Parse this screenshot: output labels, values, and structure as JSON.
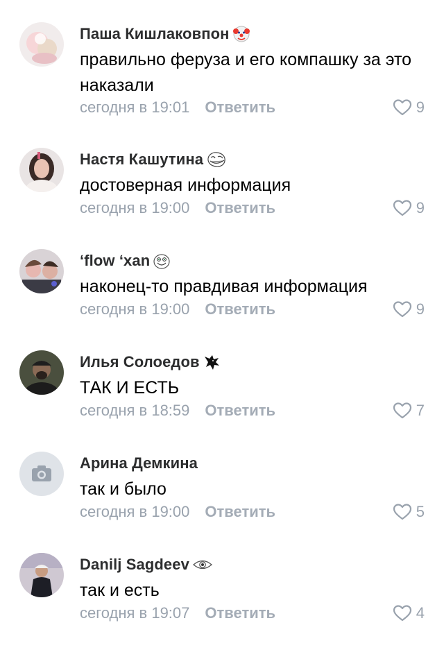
{
  "reply_label": "Ответить",
  "comments": [
    {
      "author": "Паша Кишлаковпон",
      "badge": "clown-face-icon",
      "text": "правильно феруза и его компашку за это наказали",
      "time": "сегодня в 19:01",
      "likes": "9"
    },
    {
      "author": "Настя Кашутина",
      "badge": "trollface-icon",
      "text": "достоверная информация",
      "time": "сегодня в 19:00",
      "likes": "9"
    },
    {
      "author": "ʻflow ʻxan",
      "badge": "happy-face-icon",
      "text": "наконец-то правдивая информация",
      "time": "сегодня в 19:00",
      "likes": "9"
    },
    {
      "author": "Илья Солоедов",
      "badge": "dragon-logo-icon",
      "text": "ТАК И ЕСТЬ",
      "time": "сегодня в 18:59",
      "likes": "7"
    },
    {
      "author": "Арина Демкина",
      "badge": "",
      "text": "так и было",
      "time": "сегодня в 19:00",
      "likes": "5"
    },
    {
      "author": "Danilj Sagdeev",
      "badge": "eye-icon",
      "text": "так и есть",
      "time": "сегодня в 19:07",
      "likes": "4"
    }
  ],
  "colors": {
    "meta_text": "#99a2ad",
    "author_text": "#2c2d2e",
    "camera_placeholder_bg": "#dfe3e8",
    "camera_placeholder_icon": "#99a2ad"
  }
}
